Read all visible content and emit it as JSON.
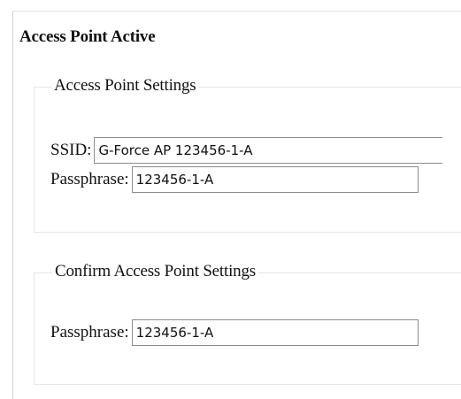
{
  "page": {
    "title": "Access Point Active"
  },
  "ap_settings": {
    "legend": "Access Point Settings",
    "ssid_label": "SSID:",
    "ssid_value": "G-Force AP 123456-1-A",
    "passphrase_label": "Passphrase:",
    "passphrase_value": "123456-1-A"
  },
  "confirm_settings": {
    "legend": "Confirm Access Point Settings",
    "passphrase_label": "Passphrase:",
    "passphrase_value": "123456-1-A"
  }
}
